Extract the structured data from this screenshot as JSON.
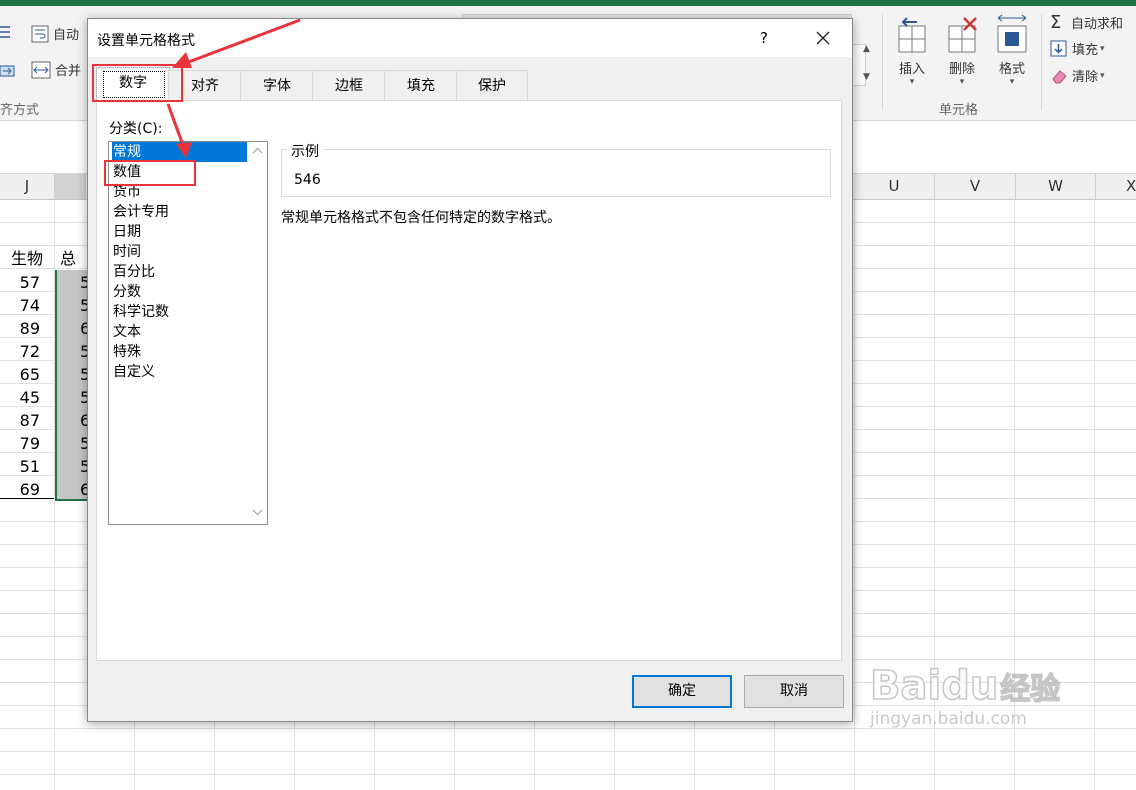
{
  "ribbon": {
    "autowrap_label": "自动",
    "merge_label": "合并",
    "align_group": "齐方式",
    "insert_label": "插入",
    "delete_label": "删除",
    "format_label": "格式",
    "cells_group": "单元格",
    "autosum_label": "自动求和",
    "fill_label": "填充",
    "clear_label": "清除"
  },
  "grid": {
    "col_headers": [
      "J",
      "U",
      "V",
      "W",
      "X"
    ],
    "header_cells": [
      "生物",
      "总"
    ],
    "bio_values": [
      "57",
      "74",
      "89",
      "72",
      "65",
      "45",
      "87",
      "79",
      "51",
      "69"
    ],
    "total_partial": [
      "5",
      "5",
      "6",
      "5",
      "5",
      "5",
      "6",
      "5",
      "5",
      "6"
    ]
  },
  "dialog": {
    "title": "设置单元格格式",
    "help": "?",
    "tabs": [
      "数字",
      "对齐",
      "字体",
      "边框",
      "填充",
      "保护"
    ],
    "category_label": "分类(C):",
    "categories": [
      "常规",
      "数值",
      "货币",
      "会计专用",
      "日期",
      "时间",
      "百分比",
      "分数",
      "科学记数",
      "文本",
      "特殊",
      "自定义"
    ],
    "selected_category": "常规",
    "sample_title": "示例",
    "sample_value": "546",
    "description": "常规单元格格式不包含任何特定的数字格式。",
    "ok": "确定",
    "cancel": "取消"
  },
  "watermark": {
    "brand": "Baidu",
    "brand_cn": "经验",
    "url": "jingyan.baidu.com"
  },
  "colors": {
    "excel_green": "#217346",
    "selection_blue": "#0078d7",
    "annotation_red": "#e8343a"
  }
}
